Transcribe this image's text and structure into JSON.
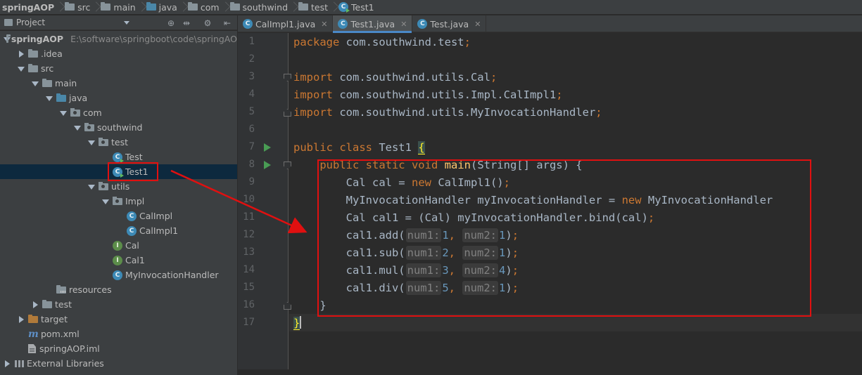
{
  "breadcrumb": [
    {
      "label": "springAOP",
      "bold": true,
      "icon": "none"
    },
    {
      "label": "src",
      "icon": "folder-icon"
    },
    {
      "label": "main",
      "icon": "folder-icon"
    },
    {
      "label": "java",
      "icon": "folder-blue-icon"
    },
    {
      "label": "com",
      "icon": "folder-icon"
    },
    {
      "label": "southwind",
      "icon": "folder-icon"
    },
    {
      "label": "test",
      "icon": "folder-icon"
    },
    {
      "label": "Test1",
      "icon": "class-icon"
    }
  ],
  "project_panel": {
    "title": "Project",
    "tree": [
      {
        "label": "springAOP",
        "extra": "E:\\software\\springboot\\code\\springAO",
        "depth": 0,
        "arrow": "down",
        "icon": "folder-icon",
        "bold": true
      },
      {
        "label": ".idea",
        "depth": 1,
        "arrow": "right",
        "icon": "folder-icon"
      },
      {
        "label": "src",
        "depth": 1,
        "arrow": "down",
        "icon": "folder-icon"
      },
      {
        "label": "main",
        "depth": 2,
        "arrow": "down",
        "icon": "folder-icon"
      },
      {
        "label": "java",
        "depth": 3,
        "arrow": "down",
        "icon": "folder-blue-icon"
      },
      {
        "label": "com",
        "depth": 4,
        "arrow": "down",
        "icon": "package-icon"
      },
      {
        "label": "southwind",
        "depth": 5,
        "arrow": "down",
        "icon": "package-icon"
      },
      {
        "label": "test",
        "depth": 6,
        "arrow": "down",
        "icon": "package-icon"
      },
      {
        "label": "Test",
        "depth": 7,
        "arrow": "none",
        "icon": "class-main-icon"
      },
      {
        "label": "Test1",
        "depth": 7,
        "arrow": "none",
        "icon": "class-main-icon",
        "selected": true
      },
      {
        "label": "utils",
        "depth": 6,
        "arrow": "down",
        "icon": "package-icon"
      },
      {
        "label": "Impl",
        "depth": 7,
        "arrow": "down",
        "icon": "package-icon"
      },
      {
        "label": "CalImpl",
        "depth": 8,
        "arrow": "none",
        "icon": "class-icon"
      },
      {
        "label": "CalImpl1",
        "depth": 8,
        "arrow": "none",
        "icon": "class-icon"
      },
      {
        "label": "Cal",
        "depth": 7,
        "arrow": "none",
        "icon": "interface-icon"
      },
      {
        "label": "Cal1",
        "depth": 7,
        "arrow": "none",
        "icon": "interface-icon"
      },
      {
        "label": "MyInvocationHandler",
        "depth": 7,
        "arrow": "none",
        "icon": "class-icon"
      },
      {
        "label": "resources",
        "depth": 3,
        "arrow": "none",
        "icon": "folder-resources-icon"
      },
      {
        "label": "test",
        "depth": 2,
        "arrow": "right",
        "icon": "folder-icon"
      },
      {
        "label": "target",
        "depth": 1,
        "arrow": "right",
        "icon": "folder-orange-icon"
      },
      {
        "label": "pom.xml",
        "depth": 1,
        "arrow": "none",
        "icon": "maven-icon"
      },
      {
        "label": "springAOP.iml",
        "depth": 1,
        "arrow": "none",
        "icon": "file-icon"
      },
      {
        "label": "External Libraries",
        "depth": 0,
        "arrow": "right",
        "icon": "library-icon"
      }
    ]
  },
  "tabs": [
    {
      "label": "CalImpl1.java",
      "active": false
    },
    {
      "label": "Test1.java",
      "active": true
    },
    {
      "label": "Test.java",
      "active": false
    }
  ],
  "editor": {
    "line_numbers": [
      "1",
      "2",
      "3",
      "4",
      "5",
      "6",
      "7",
      "8",
      "9",
      "10",
      "11",
      "12",
      "13",
      "14",
      "15",
      "16",
      "17"
    ],
    "lines": [
      [
        {
          "t": "package",
          "c": "kw"
        },
        {
          "t": " com.southwind.test"
        },
        {
          "t": ";",
          "c": "kw"
        }
      ],
      [],
      [
        {
          "t": "import",
          "c": "kw"
        },
        {
          "t": " com.southwind.utils.Cal"
        },
        {
          "t": ";",
          "c": "kw"
        }
      ],
      [
        {
          "t": "import",
          "c": "kw"
        },
        {
          "t": " com.southwind.utils.Impl.CalImpl1"
        },
        {
          "t": ";",
          "c": "kw"
        }
      ],
      [
        {
          "t": "import",
          "c": "kw"
        },
        {
          "t": " com.southwind.utils.MyInvocationHandler"
        },
        {
          "t": ";",
          "c": "kw"
        }
      ],
      [],
      [
        {
          "t": "public class",
          "c": "kw"
        },
        {
          "t": " Test1 "
        },
        {
          "t": "{",
          "c": "brace"
        }
      ],
      [
        {
          "t": "    "
        },
        {
          "t": "public static void",
          "c": "kw"
        },
        {
          "t": " "
        },
        {
          "t": "main",
          "c": "fn"
        },
        {
          "t": "(String[] args) {"
        }
      ],
      [
        {
          "t": "        Cal cal = "
        },
        {
          "t": "new",
          "c": "kw"
        },
        {
          "t": " CalImpl1()"
        },
        {
          "t": ";",
          "c": "kw"
        }
      ],
      [
        {
          "t": "        MyInvocationHandler myInvocationHandler = "
        },
        {
          "t": "new",
          "c": "kw"
        },
        {
          "t": " MyInvocationHandler"
        }
      ],
      [
        {
          "t": "        Cal cal1 = (Cal) myInvocationHandler.bind(cal)"
        },
        {
          "t": ";",
          "c": "kw"
        }
      ],
      [
        {
          "t": "        cal1.add("
        },
        {
          "t": "num1:",
          "c": "hint"
        },
        {
          "t": "1",
          "c": "num"
        },
        {
          "t": ",",
          "c": "kw"
        },
        {
          "t": " "
        },
        {
          "t": "num2:",
          "c": "hint"
        },
        {
          "t": "1",
          "c": "num"
        },
        {
          "t": ")"
        },
        {
          "t": ";",
          "c": "kw"
        }
      ],
      [
        {
          "t": "        cal1.sub("
        },
        {
          "t": "num1:",
          "c": "hint"
        },
        {
          "t": "2",
          "c": "num"
        },
        {
          "t": ",",
          "c": "kw"
        },
        {
          "t": " "
        },
        {
          "t": "num2:",
          "c": "hint"
        },
        {
          "t": "1",
          "c": "num"
        },
        {
          "t": ")"
        },
        {
          "t": ";",
          "c": "kw"
        }
      ],
      [
        {
          "t": "        cal1.mul("
        },
        {
          "t": "num1:",
          "c": "hint"
        },
        {
          "t": "3",
          "c": "num"
        },
        {
          "t": ",",
          "c": "kw"
        },
        {
          "t": " "
        },
        {
          "t": "num2:",
          "c": "hint"
        },
        {
          "t": "4",
          "c": "num"
        },
        {
          "t": ")"
        },
        {
          "t": ";",
          "c": "kw"
        }
      ],
      [
        {
          "t": "        cal1.div("
        },
        {
          "t": "num1:",
          "c": "hint"
        },
        {
          "t": "5",
          "c": "num"
        },
        {
          "t": ",",
          "c": "kw"
        },
        {
          "t": " "
        },
        {
          "t": "num2:",
          "c": "hint"
        },
        {
          "t": "1",
          "c": "num"
        },
        {
          "t": ")"
        },
        {
          "t": ";",
          "c": "kw"
        }
      ],
      [
        {
          "t": "    }"
        }
      ],
      [
        {
          "t": "}",
          "c": "brace-caret"
        }
      ]
    ]
  },
  "colors": {
    "keyword": "#cc7832",
    "method": "#ffc66d",
    "number": "#6897bb",
    "annotation_red": "#e01010",
    "selection": "#0d293e"
  }
}
